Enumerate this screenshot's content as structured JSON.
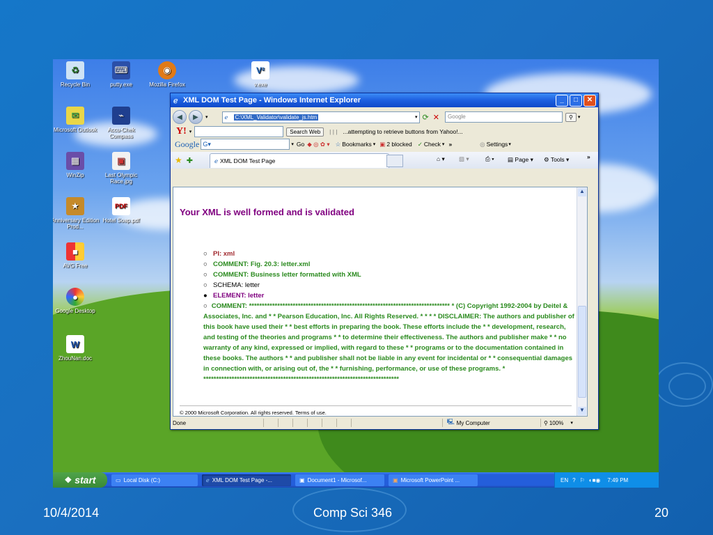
{
  "slide": {
    "date": "10/4/2014",
    "course": "Comp Sci 346",
    "page_number": "20"
  },
  "desktop": {
    "icons": [
      {
        "label": "Recycle Bin",
        "icon": "recycle-bin-icon"
      },
      {
        "label": "putty.exe",
        "icon": "putty-icon"
      },
      {
        "label": "Mozilla Firefox",
        "icon": "firefox-icon"
      },
      {
        "label": "v.exe",
        "icon": "vnc-icon"
      },
      {
        "label": "Microsoft Outlook",
        "icon": "outlook-icon"
      },
      {
        "label": "Accu-Chek Compass",
        "icon": "accu-chek-icon"
      },
      {
        "label": "WinZip",
        "icon": "winzip-icon"
      },
      {
        "label": "Last Olympic Race.jpg",
        "icon": "image-file-icon"
      },
      {
        "label": "Anniversary Edition Prod...",
        "icon": "shortcut-icon"
      },
      {
        "label": "Hotel Soap.pdf",
        "icon": "pdf-icon"
      },
      {
        "label": "AVG Free",
        "icon": "avg-icon"
      },
      {
        "label": "Google Desktop",
        "icon": "google-desktop-icon"
      },
      {
        "label": "ZhouNan.doc",
        "icon": "word-doc-icon"
      }
    ]
  },
  "window": {
    "title": "XML DOM Test Page - Windows Internet Explorer",
    "address": "C:\\XML_Validator\\validate_js.htm",
    "search_placeholder": "Google",
    "yahoo": {
      "search_button": "Search Web",
      "status": "...attempting to retrieve buttons from Yahoo!..."
    },
    "google": {
      "go": "Go",
      "bookmarks": "Bookmarks",
      "blocked": "2 blocked",
      "check": "Check",
      "settings": "Settings"
    },
    "tab_label": "XML DOM Test Page",
    "tools": {
      "page": "Page",
      "tools": "Tools"
    },
    "status_text": "Done",
    "zone": "My Computer",
    "zoom": "100%"
  },
  "page": {
    "heading": "Your XML is well formed and is validated",
    "items": [
      {
        "bullet": "○",
        "text": "PI: xml",
        "style": "red"
      },
      {
        "bullet": "○",
        "text": "COMMENT: Fig. 20.3: letter.xml",
        "style": "green"
      },
      {
        "bullet": "○",
        "text": "COMMENT: Business letter formatted with XML",
        "style": "green"
      },
      {
        "bullet": "○",
        "text": "SCHEMA: letter",
        "style": "black"
      },
      {
        "bullet": "●",
        "text": "ELEMENT: letter",
        "style": "purple"
      }
    ],
    "long_comment": "COMMENT: ****************************************************************************** * (C) Copyright 1992-2004 by Deitel & Associates, Inc. and * * Pearson Education, Inc. All Rights Reserved. * * * * DISCLAIMER: The authors and publisher of this book have used their * * best efforts in preparing the book. These efforts include the * * development, research, and testing of the theories and programs * * to determine their effectiveness. The authors and publisher make * * no warranty of any kind, expressed or implied, with regard to these * * programs or to the documentation contained in these books. The authors * * and publisher shall not be liable in any event for incidental or * * consequential damages in connection with, or arising out of, the * * furnishing, performance, or use of these programs. * ****************************************************************************",
    "copyright": "© 2000 Microsoft Corporation. All rights reserved. Terms of use."
  },
  "taskbar": {
    "start": "start",
    "tasks": [
      "Local Disk (C:)",
      "XML DOM Test Page -...",
      "Document1 - Microsof...",
      "Microsoft PowerPoint ..."
    ],
    "lang": "EN",
    "time": "7:49 PM"
  }
}
